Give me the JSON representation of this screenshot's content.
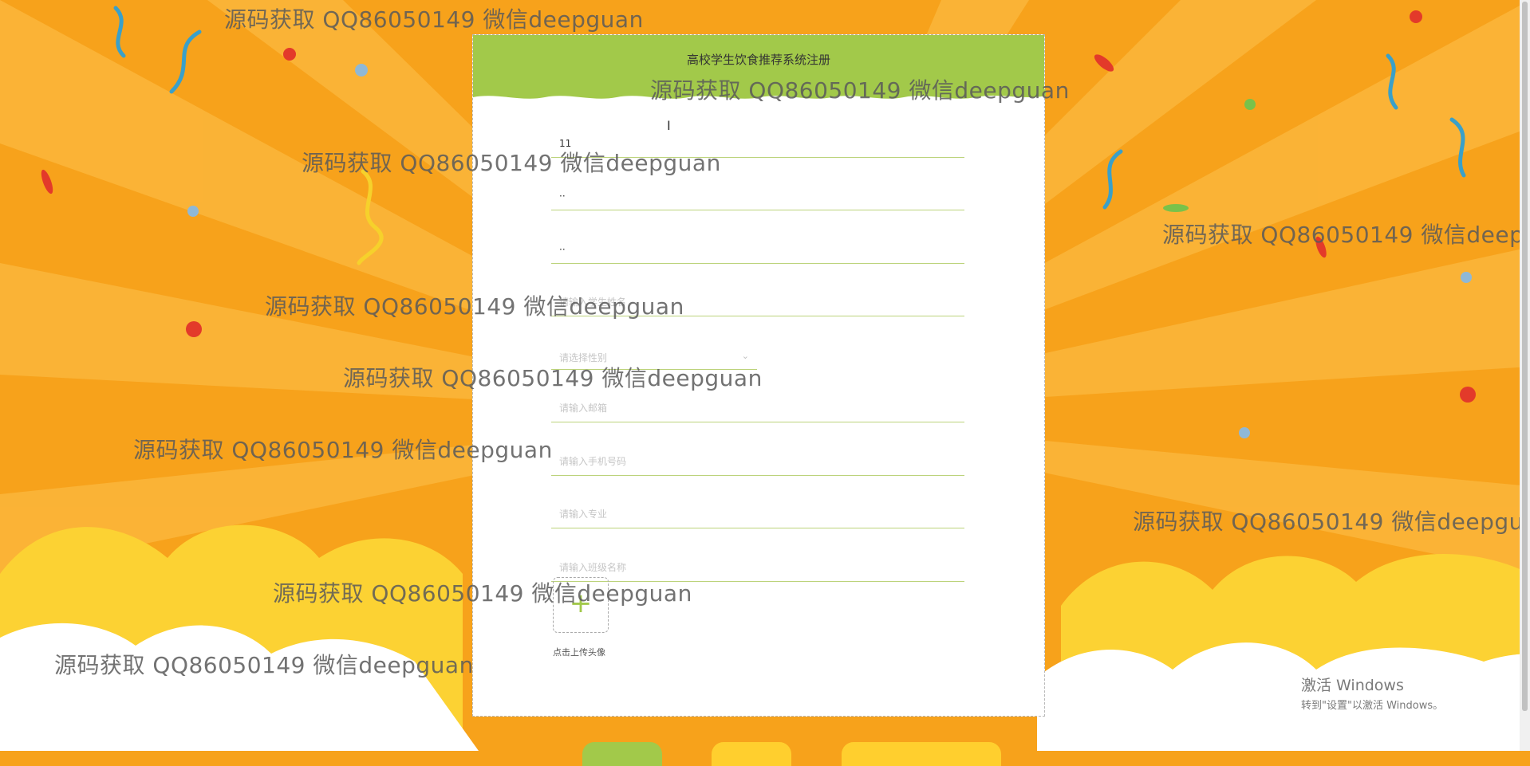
{
  "form": {
    "title": "高校学生饮食推荐系统注册",
    "fields": [
      {
        "value": "11",
        "placeholder": ""
      },
      {
        "value": "··",
        "placeholder": ""
      },
      {
        "value": "··",
        "placeholder": ""
      },
      {
        "value": "",
        "placeholder": "请输入学生姓名"
      },
      {
        "value": "",
        "placeholder": "请输入邮箱"
      },
      {
        "value": "",
        "placeholder": "请输入手机号码"
      },
      {
        "value": "",
        "placeholder": "请输入专业"
      },
      {
        "value": "",
        "placeholder": "请输入班级名称"
      }
    ],
    "gender_select": {
      "placeholder": "请选择性别"
    },
    "upload": {
      "plus": "+",
      "label": "点击上传头像"
    }
  },
  "watermark": {
    "text": "源码获取 QQ86050149 微信deepguan",
    "instances": 11
  },
  "windows_activation": {
    "line1": "激活 Windows",
    "line2": "转到\"设置\"以激活 Windows。"
  },
  "colors": {
    "background": "#f7a21b",
    "header": "#a2c94a",
    "field_underline": "#bcd37b",
    "button_green": "#a2c94a",
    "button_yellow": "#ffcf2e"
  }
}
